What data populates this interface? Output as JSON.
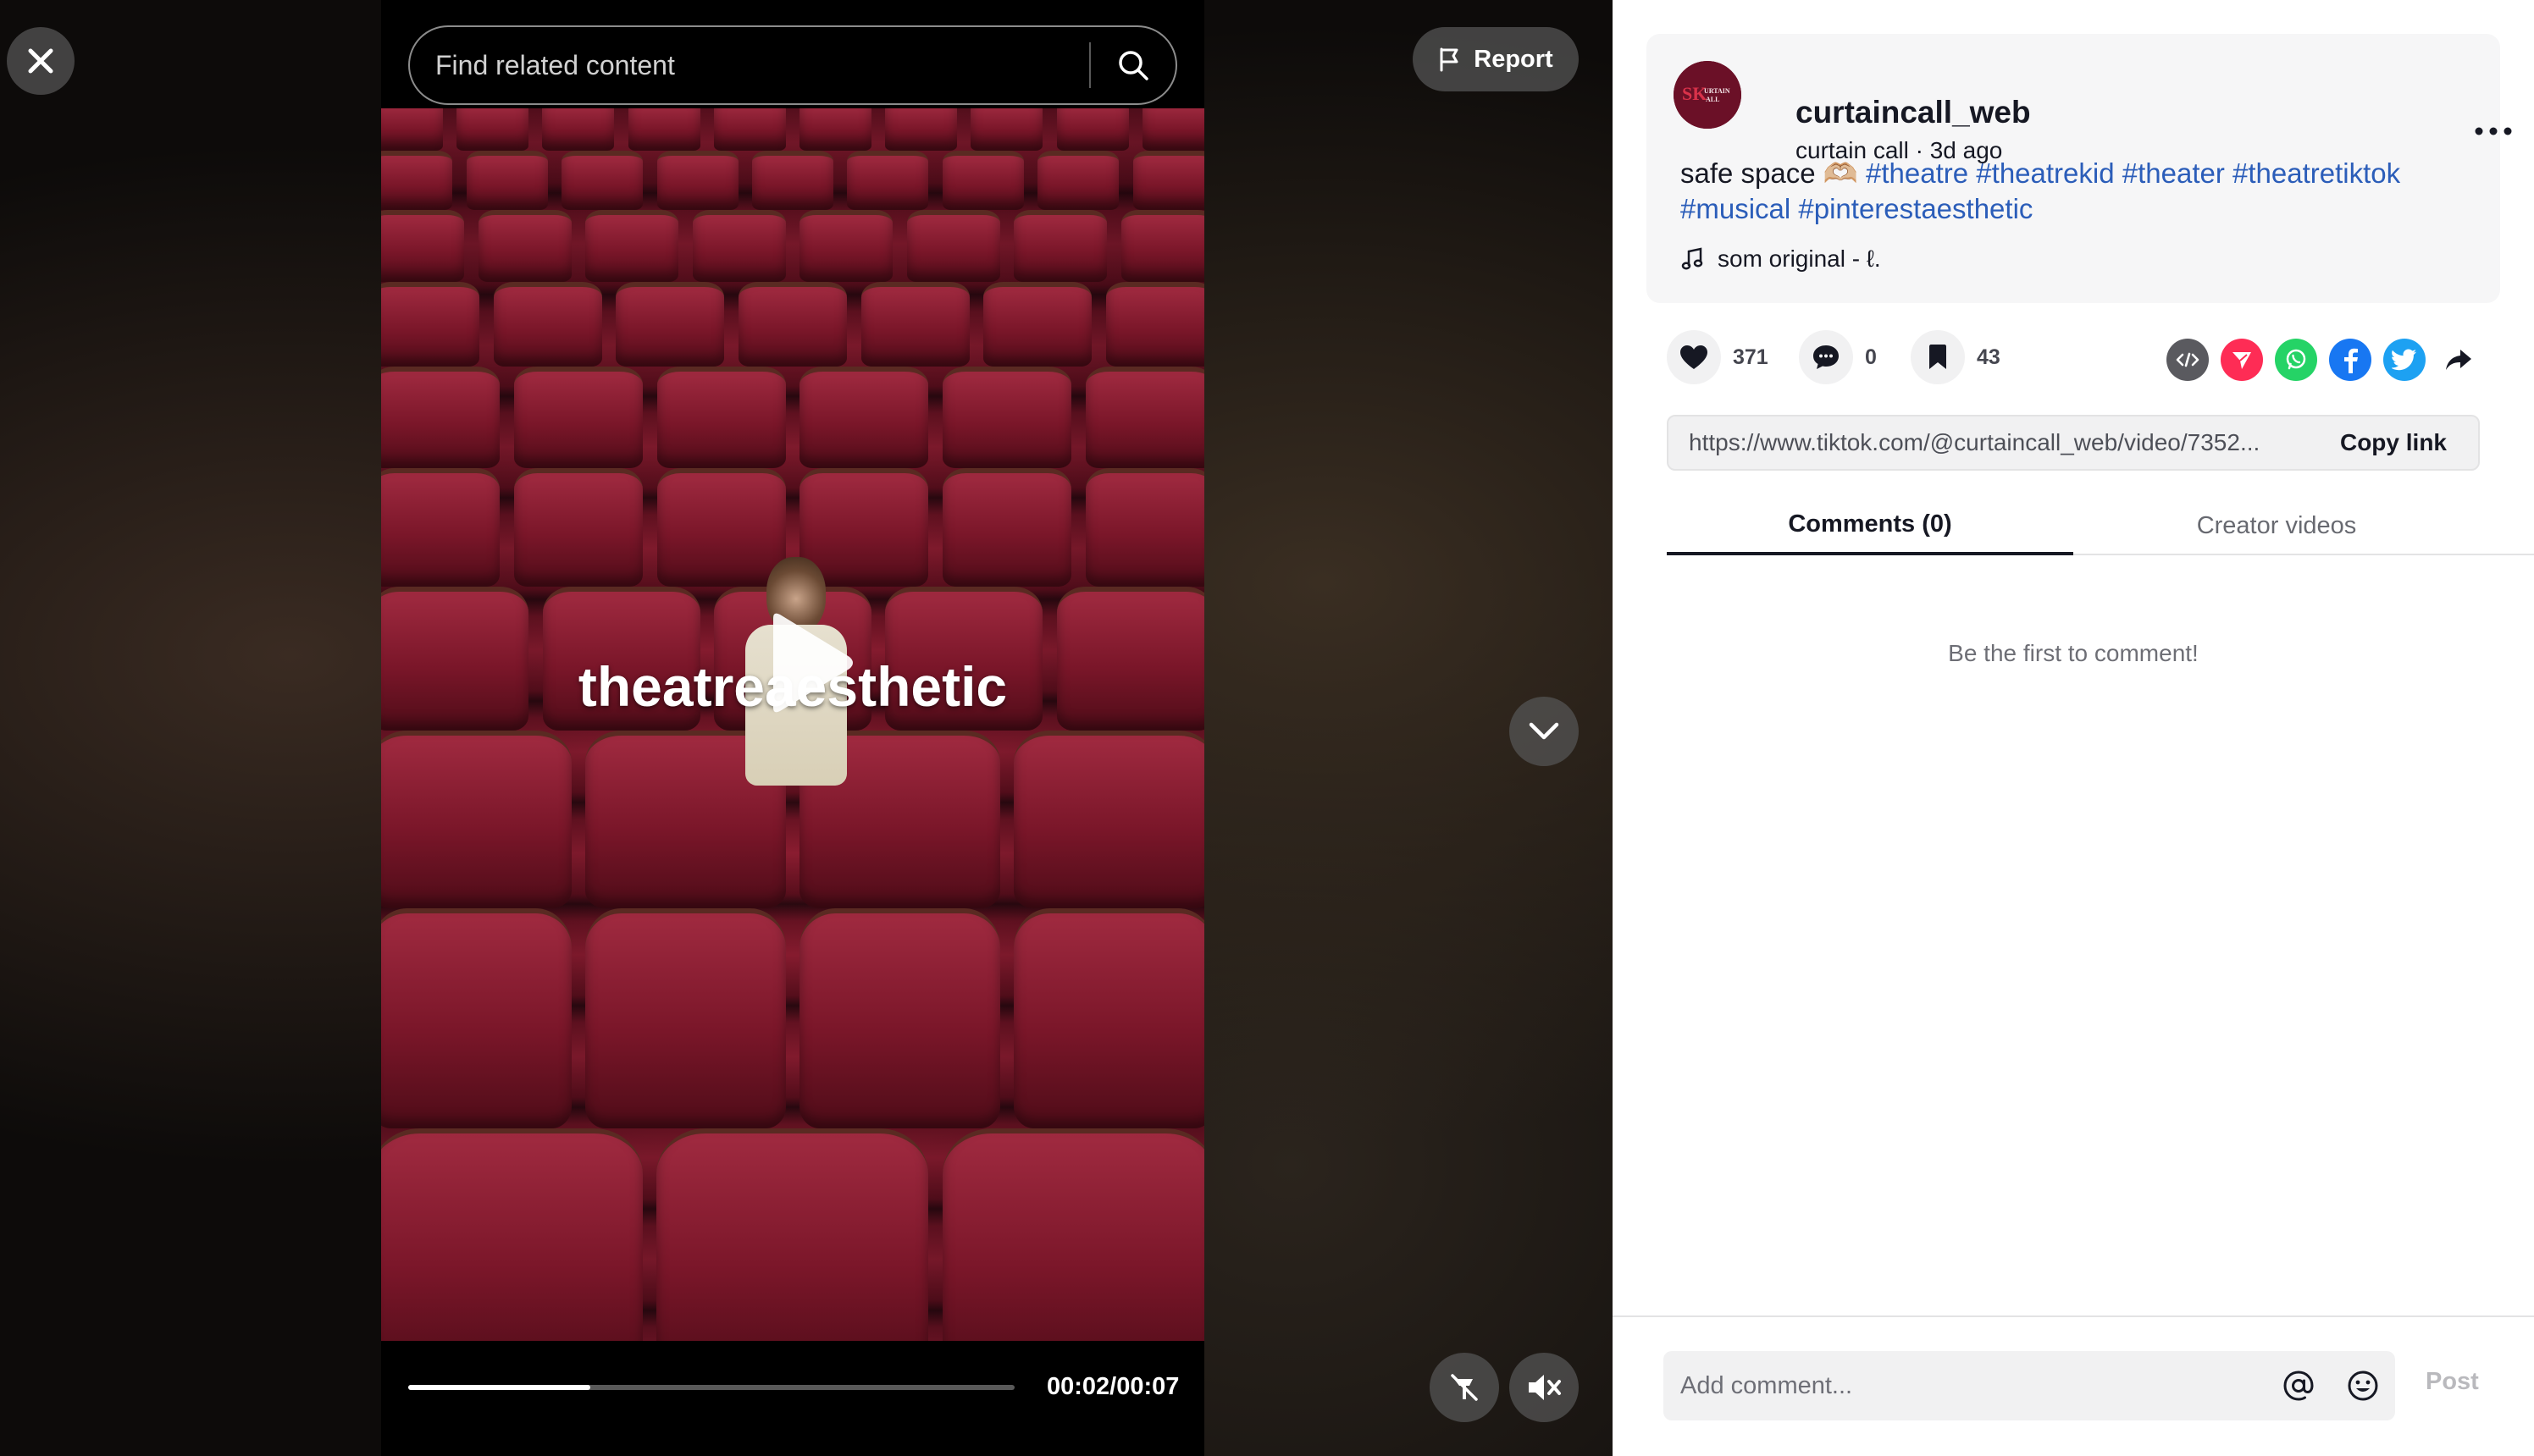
{
  "player": {
    "search_placeholder": "Find related content",
    "report_label": "Report",
    "overlay_caption": "theatreaesthetic",
    "progress_fraction": 0.3,
    "current_time": "00:02",
    "duration": "00:07",
    "time_display": "00:02/00:07",
    "icons": {
      "close": "close-icon",
      "search": "search-icon",
      "report": "flag-icon",
      "play": "play-icon",
      "next": "chevron-down-icon",
      "float": "floating-player-icon",
      "mute": "volume-muted-icon"
    }
  },
  "post": {
    "username": "curtaincall_web",
    "display_name": "curtain call",
    "separator": " · ",
    "posted": "3d ago",
    "caption_text": "safe space 🫶🏼",
    "hashtags": [
      "#theatre",
      "#theatrekid",
      "#theater",
      "#theatretiktok",
      "#musical",
      "#pinterestaesthetic"
    ],
    "music": "som original - ℓ.",
    "avatar_text": "CURTAIN CALL"
  },
  "actions": {
    "likes": "371",
    "comments": "0",
    "saves": "43",
    "share_targets": [
      "embed",
      "send",
      "whatsapp",
      "facebook",
      "twitter",
      "share"
    ]
  },
  "link": {
    "url": "https://www.tiktok.com/@curtaincall_web/video/7352...",
    "copy_label": "Copy link"
  },
  "tabs": [
    {
      "label": "Comments (0)",
      "active": true
    },
    {
      "label": "Creator videos",
      "active": false
    }
  ],
  "comments": {
    "empty_text": "Be the first to comment!",
    "input_placeholder": "Add comment...",
    "post_label": "Post"
  },
  "colors": {
    "hashtag": "#2b5db9",
    "like": "#161823",
    "send": "#fe2c55",
    "whatsapp": "#25d366",
    "facebook": "#1877f2",
    "twitter": "#1da1f2",
    "embed": "#5a5a5f",
    "seat_red": "#8d1d31"
  }
}
